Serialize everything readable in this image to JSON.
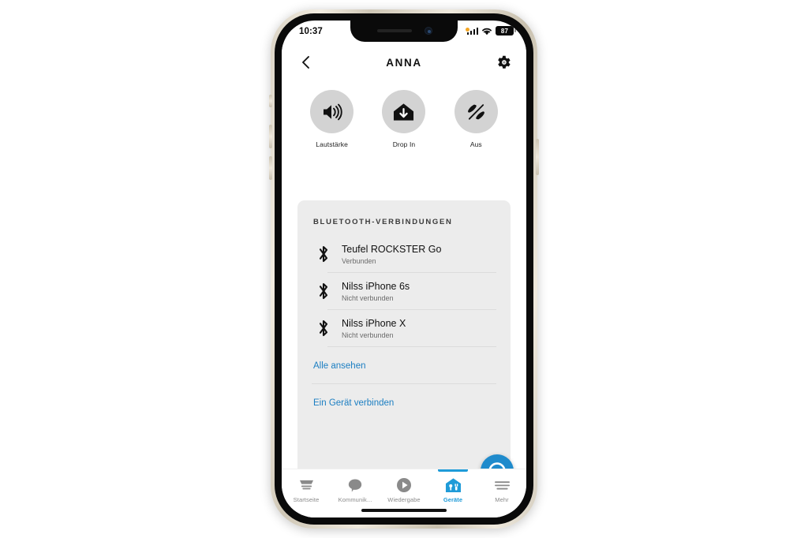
{
  "device": {
    "status_bar": {
      "time": "10:37",
      "battery_level": "87",
      "signal_icon": "cellular-signal-icon",
      "wifi_icon": "wifi-icon",
      "battery_icon": "battery-icon",
      "recording_dot_color": "#f5a623"
    }
  },
  "nav": {
    "back_icon": "chevron-left-icon",
    "title": "ANNA",
    "settings_icon": "gear-icon"
  },
  "quick_actions": [
    {
      "label": "Lautstärke",
      "icon": "speaker-volume-icon"
    },
    {
      "label": "Drop In",
      "icon": "drop-in-house-arrow-icon"
    },
    {
      "label": "Aus",
      "icon": "announce-muted-icon"
    }
  ],
  "bluetooth_card": {
    "title": "BLUETOOTH-VERBINDUNGEN",
    "devices": [
      {
        "name": "Teufel ROCKSTER Go",
        "status": "Verbunden",
        "icon": "bluetooth-icon"
      },
      {
        "name": "Nilss iPhone 6s",
        "status": "Nicht verbunden",
        "icon": "bluetooth-icon"
      },
      {
        "name": "Nilss iPhone X",
        "status": "Nicht verbunden",
        "icon": "bluetooth-icon"
      }
    ],
    "see_all_label": "Alle ansehen",
    "connect_device_label": "Ein Gerät verbinden"
  },
  "fab": {
    "alexa_icon": "alexa-logo-icon",
    "add_icon": "plus-icon",
    "color": "#1f8bcc"
  },
  "tabbar": {
    "active_color": "#1f9bd8",
    "inactive_color": "#8a8a8a",
    "items": [
      {
        "label": "Startseite",
        "icon": "home-shade-icon",
        "active": false
      },
      {
        "label": "Kommunik...",
        "icon": "speech-bubble-icon",
        "active": false
      },
      {
        "label": "Wiedergabe",
        "icon": "play-circle-icon",
        "active": false
      },
      {
        "label": "Geräte",
        "icon": "devices-house-icon",
        "active": true
      },
      {
        "label": "Mehr",
        "icon": "hamburger-menu-icon",
        "active": false
      }
    ]
  }
}
